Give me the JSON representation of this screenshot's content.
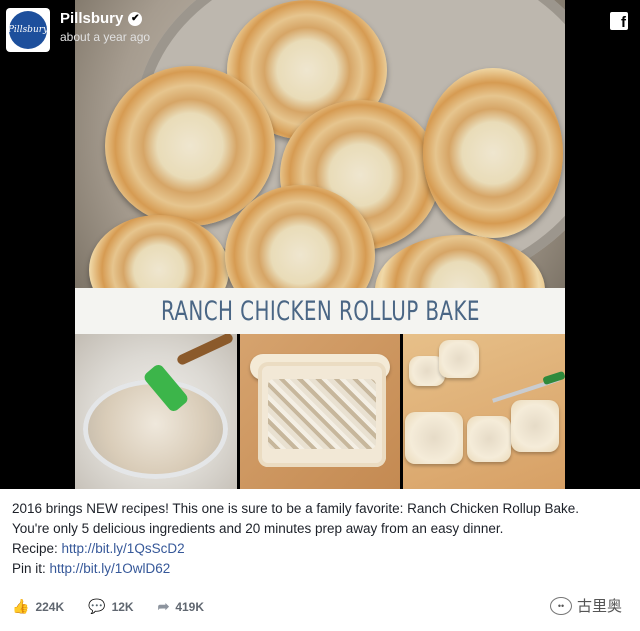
{
  "page": {
    "name": "Pillsbury",
    "timestamp": "about a year ago",
    "avatar_text": "Pillsbury",
    "verified_icon": "verified-check-icon",
    "network_icon": "facebook-icon"
  },
  "media": {
    "title": "RANCH CHICKEN ROLLUP BAKE"
  },
  "caption": {
    "line1": "2016 brings NEW recipes! This one is sure to be a family favorite: Ranch Chicken Rollup Bake.",
    "line2": "You're only 5 delicious ingredients and 20 minutes prep away from an easy dinner.",
    "recipe_label": "Recipe: ",
    "recipe_link": "http://bit.ly/1QsScD2",
    "pin_label": "Pin it: ",
    "pin_link": "http://bit.ly/1OwlD62"
  },
  "stats": {
    "likes": "224K",
    "comments": "12K",
    "shares": "419K"
  },
  "watermark": {
    "text": "古里奥"
  }
}
